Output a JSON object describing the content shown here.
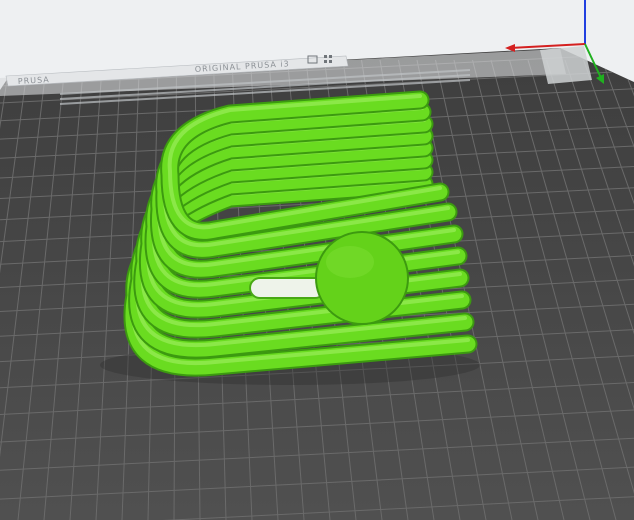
{
  "viewport": {
    "background": "#eef0f2",
    "plate_color": "#4a4a4a",
    "grid_color": "#6a6a6a",
    "model_color": "#6adc20"
  },
  "bed": {
    "label_left": "PRUSA",
    "label_center": "ORIGINAL PRUSA i3",
    "label_right_icons": [
      "printer-logo-icon",
      "grid-logo-icon"
    ]
  },
  "axes": {
    "x_color": "#d42020",
    "y_color": "#20b020",
    "z_color": "#2040e0",
    "labels": [
      "X",
      "Y",
      "Z"
    ]
  },
  "model": {
    "name": "",
    "features": [
      "coiled-tube-holder",
      "round-disc-clip",
      "slot-opening"
    ]
  }
}
